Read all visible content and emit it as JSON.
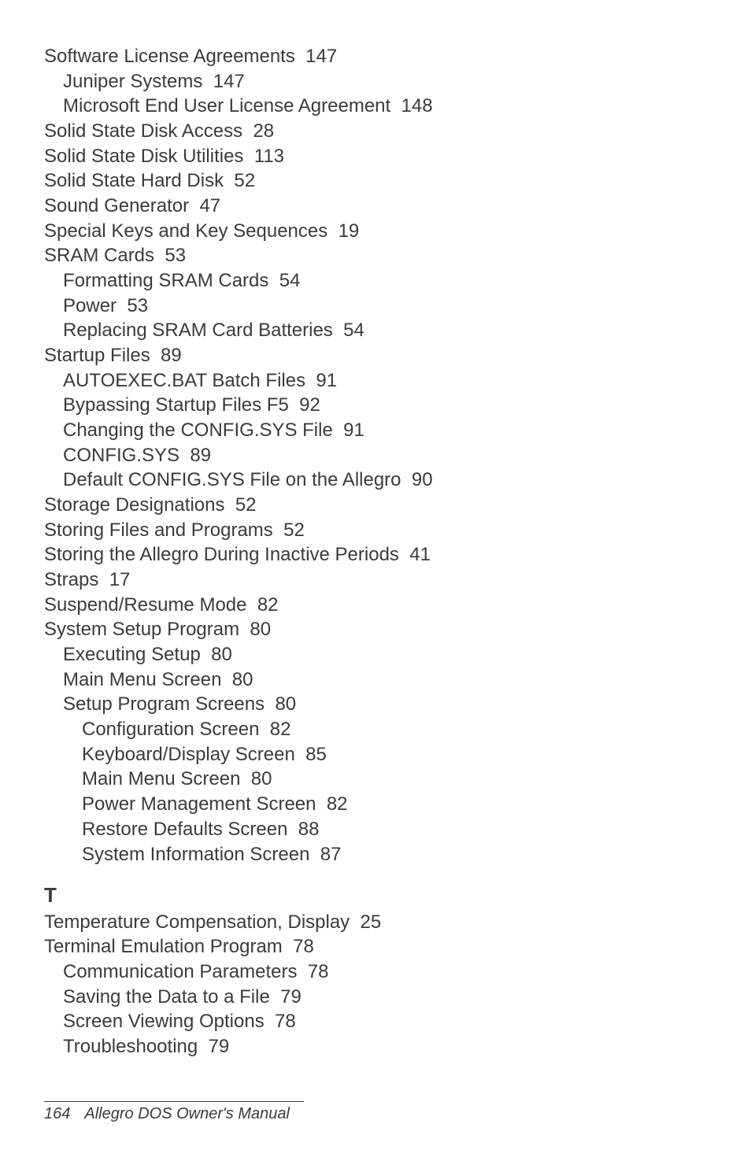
{
  "entries": [
    {
      "level": 0,
      "text": "Software License Agreements",
      "page": "147"
    },
    {
      "level": 1,
      "text": "Juniper Systems",
      "page": "147"
    },
    {
      "level": 1,
      "text": "Microsoft End User License Agreement",
      "page": "148"
    },
    {
      "level": 0,
      "text": "Solid State Disk Access",
      "page": "28"
    },
    {
      "level": 0,
      "text": "Solid State Disk Utilities",
      "page": "113"
    },
    {
      "level": 0,
      "text": "Solid State Hard Disk",
      "page": "52"
    },
    {
      "level": 0,
      "text": "Sound Generator",
      "page": "47"
    },
    {
      "level": 0,
      "text": "Special Keys and Key Sequences",
      "page": "19"
    },
    {
      "level": 0,
      "text": "SRAM Cards",
      "page": "53"
    },
    {
      "level": 1,
      "text": "Formatting SRAM Cards",
      "page": "54"
    },
    {
      "level": 1,
      "text": "Power",
      "page": "53"
    },
    {
      "level": 1,
      "text": "Replacing SRAM Card Batteries",
      "page": "54"
    },
    {
      "level": 0,
      "text": "Startup Files",
      "page": "89"
    },
    {
      "level": 1,
      "text": "AUTOEXEC.BAT Batch Files",
      "page": "91"
    },
    {
      "level": 1,
      "text": "Bypassing Startup Files F5",
      "page": "92"
    },
    {
      "level": 1,
      "text": "Changing the CONFIG.SYS File",
      "page": "91"
    },
    {
      "level": 1,
      "text": "CONFIG.SYS",
      "page": "89"
    },
    {
      "level": 1,
      "text": "Default CONFIG.SYS File on the Allegro",
      "page": "90"
    },
    {
      "level": 0,
      "text": "Storage Designations",
      "page": "52"
    },
    {
      "level": 0,
      "text": "Storing Files and Programs",
      "page": "52"
    },
    {
      "level": 0,
      "text": "Storing the Allegro During Inactive Periods",
      "page": "41"
    },
    {
      "level": 0,
      "text": "Straps",
      "page": "17"
    },
    {
      "level": 0,
      "text": "Suspend/Resume Mode",
      "page": "82"
    },
    {
      "level": 0,
      "text": "System Setup Program",
      "page": "80"
    },
    {
      "level": 1,
      "text": "Executing Setup",
      "page": "80"
    },
    {
      "level": 1,
      "text": "Main Menu Screen",
      "page": "80"
    },
    {
      "level": 1,
      "text": "Setup Program Screens",
      "page": "80"
    },
    {
      "level": 2,
      "text": "Configuration Screen",
      "page": "82"
    },
    {
      "level": 2,
      "text": "Keyboard/Display Screen",
      "page": "85"
    },
    {
      "level": 2,
      "text": "Main Menu Screen",
      "page": "80"
    },
    {
      "level": 2,
      "text": "Power Management Screen",
      "page": "82"
    },
    {
      "level": 2,
      "text": "Restore Defaults Screen",
      "page": "88"
    },
    {
      "level": 2,
      "text": "System Information Screen",
      "page": "87"
    }
  ],
  "section_letter": "T",
  "entries_t": [
    {
      "level": 0,
      "text": "Temperature Compensation, Display",
      "page": "25"
    },
    {
      "level": 0,
      "text": "Terminal Emulation Program",
      "page": "78"
    },
    {
      "level": 1,
      "text": "Communication Parameters",
      "page": "78"
    },
    {
      "level": 1,
      "text": "Saving the Data to a File",
      "page": "79"
    },
    {
      "level": 1,
      "text": "Screen Viewing Options",
      "page": "78"
    },
    {
      "level": 1,
      "text": "Troubleshooting",
      "page": "79"
    }
  ],
  "footer": {
    "page_number": "164",
    "title": "Allegro DOS Owner's Manual"
  }
}
